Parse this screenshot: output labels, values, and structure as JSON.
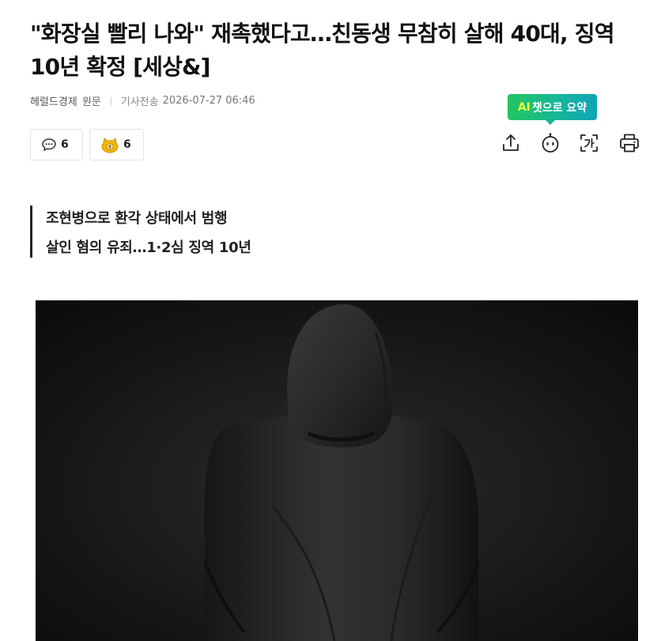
{
  "article": {
    "title": "\"화장실 빨리 나와\" 재촉했다고…친동생 무참히 살해 40대, 징역 10년 확정 [세상&]",
    "source": "헤럴드경제",
    "source_link": "원문",
    "date_label": "기사전송",
    "date": "2026-07-27 06:46",
    "lead_lines": [
      "조현병으로 환각 상태에서 범행",
      "살인 혐의 유죄…1·2심 징역 10년"
    ]
  },
  "reactions": {
    "comments": "6",
    "likes": "6"
  },
  "ai_summary": {
    "ai": "AI",
    "label": "챗으로 요약"
  },
  "icons": {
    "comment": "comment-bubble-icon",
    "like": "coin-badge-icon",
    "share": "share-icon",
    "ai": "ai-robot-icon",
    "font": "font-size-icon",
    "print": "print-icon"
  },
  "colors": {
    "ai_gradient_start": "#22c55e",
    "ai_gradient_end": "#0ea5b7",
    "ai_accent": "#eaff3a",
    "coin": "#f2b705"
  }
}
